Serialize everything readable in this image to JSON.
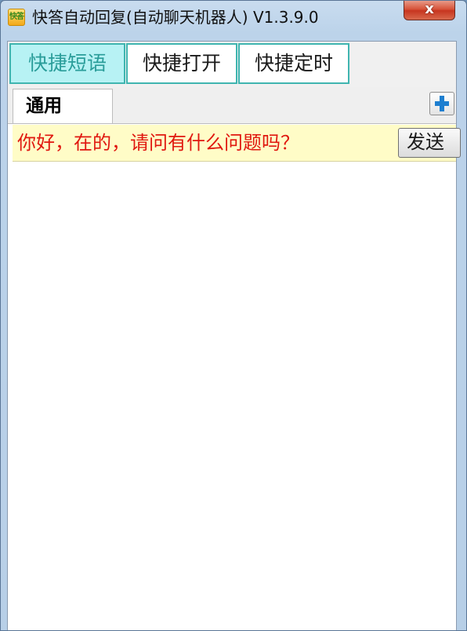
{
  "window": {
    "title": "快答自动回复(自动聊天机器人) V1.3.9.0",
    "icon_label": "快答",
    "close_label": "x",
    "icon_name": "app-logo-icon"
  },
  "main_tabs": [
    {
      "label": "快捷短语",
      "active": true
    },
    {
      "label": "快捷打开",
      "active": false
    },
    {
      "label": "快捷定时",
      "active": false
    }
  ],
  "category_tabs": [
    {
      "label": "通用",
      "active": true
    }
  ],
  "add_category_icon": "plus-icon",
  "phrases": [
    {
      "text": "你好，在的，请问有什么问题吗？",
      "send_label": "发送"
    }
  ],
  "colors": {
    "active_tab_bg": "#b7f2f4",
    "tab_border": "#3fb5b0",
    "phrase_text": "#e0170f",
    "phrase_row_bg": "#fffcc7",
    "plus_icon": "#1e7fd0"
  }
}
